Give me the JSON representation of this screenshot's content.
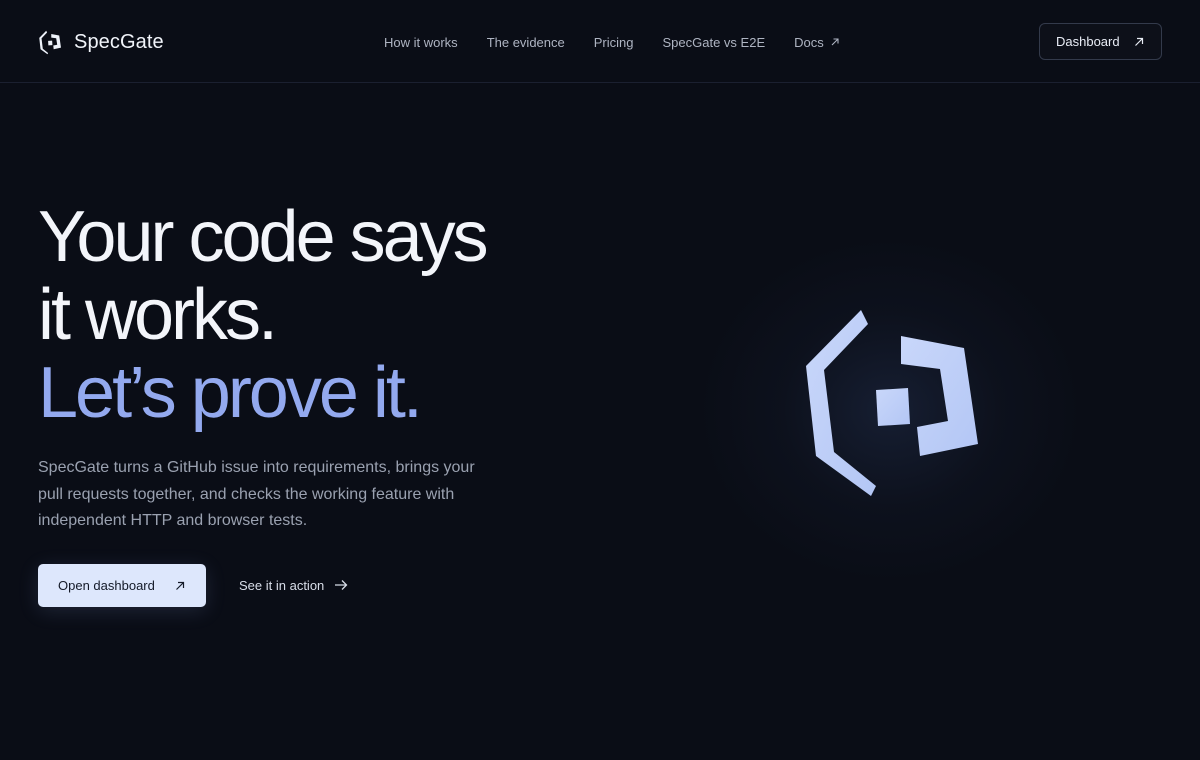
{
  "brand": {
    "name": "SpecGate",
    "icon": "specgate-logo-icon",
    "accent": "#c3d3f8"
  },
  "nav": {
    "items": [
      {
        "label": "How it works"
      },
      {
        "label": "The evidence"
      },
      {
        "label": "Pricing"
      },
      {
        "label": "SpecGate vs E2E"
      },
      {
        "label": "Docs",
        "icon": "external-arrow-icon"
      }
    ]
  },
  "header": {
    "dashboard_label": "Dashboard",
    "dashboard_icon": "arrow-up-right-icon"
  },
  "hero": {
    "title_line1": "Your code says",
    "title_line2": "it works.",
    "title_line3": "Let’s prove it.",
    "title_accent_color": "#93a9ef",
    "description": "SpecGate turns a GitHub issue into requirements, brings your pull requests together, and checks the working feature with independent HTTP and browser tests.",
    "primary_button": "Open dashboard",
    "primary_icon": "arrow-up-right-icon",
    "secondary_link": "See it in action",
    "secondary_icon": "arrow-right-icon"
  },
  "colors": {
    "background": "#0a0d16",
    "primary_button_bg": "#dde7fc",
    "muted_text": "#9aa1b0"
  }
}
